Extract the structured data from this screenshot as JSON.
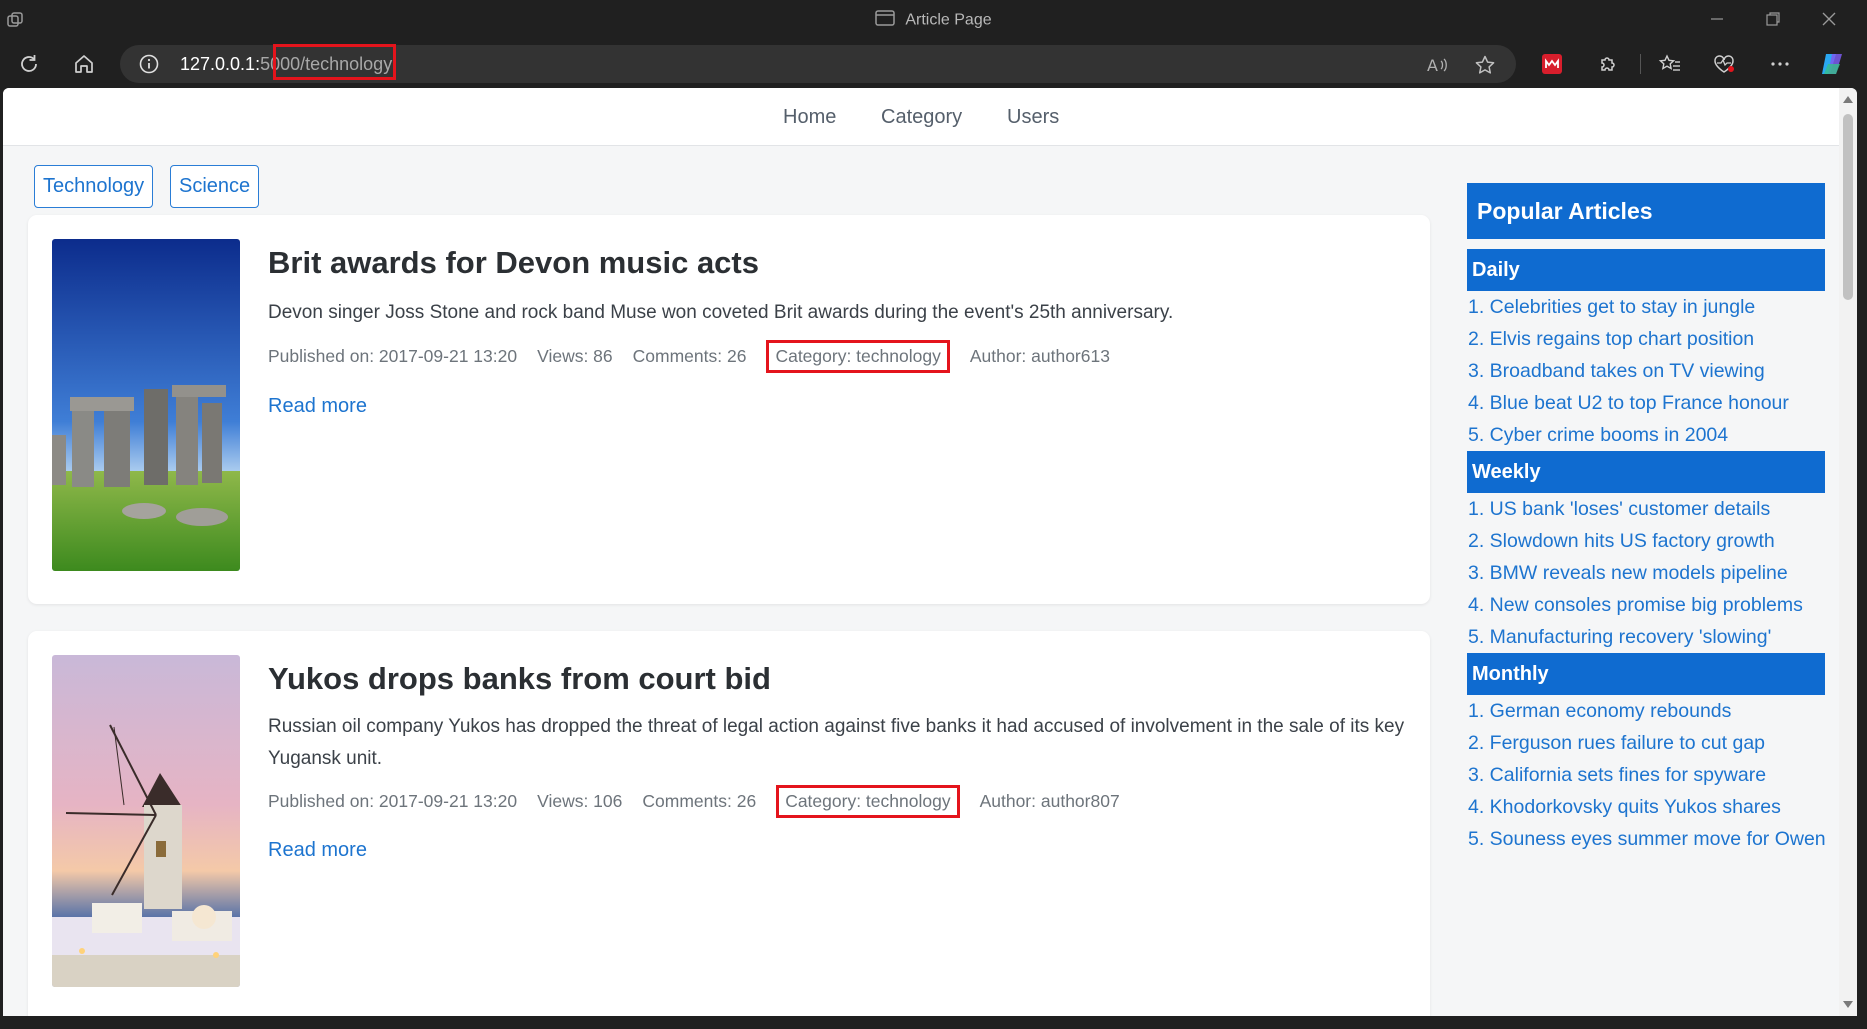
{
  "window": {
    "title": "Article Page"
  },
  "browser": {
    "url_host": "127.0.0.1:",
    "url_port": "5000",
    "url_path": "/technology"
  },
  "nav": {
    "home": "Home",
    "category": "Category",
    "users": "Users"
  },
  "categories": [
    "Technology",
    "Science"
  ],
  "articles": [
    {
      "title": "Brit awards for Devon music acts",
      "summary": "Devon singer Joss Stone and rock band Muse won coveted Brit awards during the event's 25th anniversary.",
      "published": "Published on: 2017-09-21 13:20",
      "views": "Views: 86",
      "comments": "Comments: 26",
      "category": "Category: technology",
      "author": "Author: author613",
      "read_more": "Read more"
    },
    {
      "title": "Yukos drops banks from court bid",
      "summary": "Russian oil company Yukos has dropped the threat of legal action against five banks it had accused of involvement in the sale of its key Yugansk unit.",
      "published": "Published on: 2017-09-21 13:20",
      "views": "Views: 106",
      "comments": "Comments: 26",
      "category": "Category: technology",
      "author": "Author: author807",
      "read_more": "Read more"
    }
  ],
  "sidebar": {
    "title": "Popular Articles",
    "daily": {
      "label": "Daily",
      "items": [
        "1. Celebrities get to stay in jungle",
        "2. Elvis regains top chart position",
        "3. Broadband takes on TV viewing",
        "4. Blue beat U2 to top France honour",
        "5. Cyber crime booms in 2004"
      ]
    },
    "weekly": {
      "label": "Weekly",
      "items": [
        "1. US bank 'loses' customer details",
        "2. Slowdown hits US factory growth",
        "3. BMW reveals new models pipeline",
        "4. New consoles promise big problems",
        "5. Manufacturing recovery 'slowing'"
      ]
    },
    "monthly": {
      "label": "Monthly",
      "items": [
        "1. German economy rebounds",
        "2. Ferguson rues failure to cut gap",
        "3. California sets fines for spyware",
        "4. Khodorkovsky quits Yukos shares",
        "5. Souness eyes summer move for Owen"
      ]
    }
  },
  "colors": {
    "accent": "#0f6bd0",
    "link": "#1d74cf",
    "highlight": "#e4141c"
  }
}
